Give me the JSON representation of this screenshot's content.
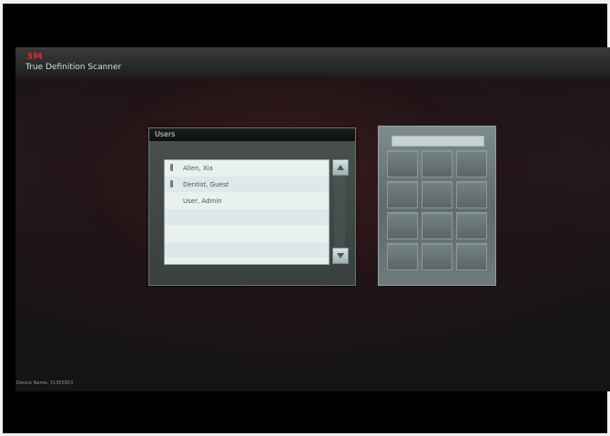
{
  "app": {
    "brand": "3M",
    "title": "True Definition Scanner"
  },
  "users_panel": {
    "title": "Users",
    "users": [
      {
        "name": "Allen, Xia",
        "has_icon": true
      },
      {
        "name": "Dentist, Guest",
        "has_icon": true
      },
      {
        "name": "User, Admin",
        "has_icon": false
      }
    ]
  },
  "keypad": {
    "display_value": "",
    "keys": [
      "",
      "",
      "",
      "",
      "",
      "",
      "",
      "",
      "",
      "",
      "",
      ""
    ]
  },
  "footer": {
    "device_name": "Device Name: 31305953"
  },
  "colors": {
    "brand": "#e0262c",
    "panel": "#3a4040",
    "list_bg": "#e9f0f0"
  }
}
